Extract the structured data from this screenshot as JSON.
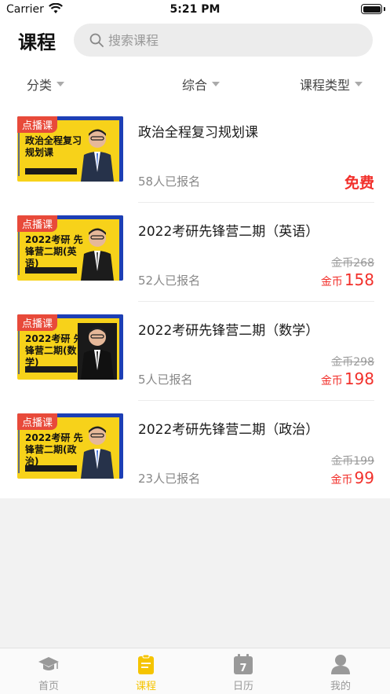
{
  "status_bar": {
    "carrier": "Carrier",
    "time": "5:21 PM"
  },
  "header": {
    "title": "课程",
    "search_placeholder": "搜索课程"
  },
  "filters": [
    {
      "label": "分类"
    },
    {
      "label": "综合"
    },
    {
      "label": "课程类型"
    }
  ],
  "courses": [
    {
      "tag": "点播课",
      "thumb_title": "政治全程复习规划课",
      "title": "政治全程复习规划课",
      "enrolled": "58人已报名",
      "price_free": "免费"
    },
    {
      "tag": "点播课",
      "thumb_title": "2022考研 先锋营二期(英语)",
      "title": "2022考研先锋营二期（英语）",
      "enrolled": "52人已报名",
      "original_price": "金币268",
      "currency": "金币",
      "price": "158"
    },
    {
      "tag": "点播课",
      "thumb_title": "2022考研 先锋营二期(数学)",
      "title": "2022考研先锋营二期（数学）",
      "enrolled": "5人已报名",
      "original_price": "金币298",
      "currency": "金币",
      "price": "198"
    },
    {
      "tag": "点播课",
      "thumb_title": "2022考研 先锋营二期(政治)",
      "title": "2022考研先锋营二期（政治）",
      "enrolled": "23人已报名",
      "original_price": "金币199",
      "currency": "金币",
      "price": "99"
    }
  ],
  "tabbar": [
    {
      "label": "首页",
      "icon": "graduation-cap-icon"
    },
    {
      "label": "课程",
      "icon": "clipboard-icon",
      "active": true
    },
    {
      "label": "日历",
      "icon": "calendar-icon",
      "calendar_day": "7"
    },
    {
      "label": "我的",
      "icon": "person-icon"
    }
  ],
  "colors": {
    "accent": "#f5c400",
    "price": "#f2302b",
    "tag": "#e84a3a",
    "thumb_bg": "#f7d21a",
    "thumb_blue": "#1d3fb5"
  }
}
